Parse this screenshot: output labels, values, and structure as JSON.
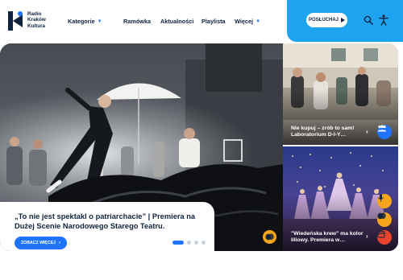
{
  "brand": {
    "line1": "Radio",
    "line2": "Kraków",
    "line3": "Kultura"
  },
  "nav": {
    "items": [
      {
        "label": "Kategorie",
        "has_dropdown": true
      },
      {
        "label": "Ramówka",
        "has_dropdown": false
      },
      {
        "label": "Aktualności",
        "has_dropdown": false
      },
      {
        "label": "Playlista",
        "has_dropdown": false
      },
      {
        "label": "Więcej",
        "has_dropdown": true
      }
    ]
  },
  "player": {
    "listen_label": "POSŁUCHAJ",
    "panel_color": "#1ea3f0"
  },
  "header_icons": [
    "search-icon",
    "accessibility-icon"
  ],
  "hero": {
    "title": "„To nie jest spektakl o patriarchacie” | Premiera na Dużej Scenie Narodowego Starego Teatru.",
    "button_label": "ZOBACZ WIĘCEJ",
    "slide_count": 4,
    "active_slide": 1,
    "category_icon": "theatre-masks-icon",
    "category_color": "#f6a51a"
  },
  "side_articles": [
    {
      "title": "Nie kupuj – zrób to sam! Laboratorium D-I-Y…",
      "category_icon": "people-group-icon",
      "category_color": "#1e73ff"
    },
    {
      "title": "\"Wiedeńska krew\" ma kolor liliowy. Premiera w…",
      "category_icons": [
        "microphone-icon",
        "theatre-masks-icon",
        "calendar-icon"
      ],
      "category_colors": [
        "#f6a51a",
        "#f6a51a",
        "#e8452c"
      ]
    }
  ],
  "colors": {
    "accent": "#1e73ff",
    "navy": "#10233f"
  }
}
